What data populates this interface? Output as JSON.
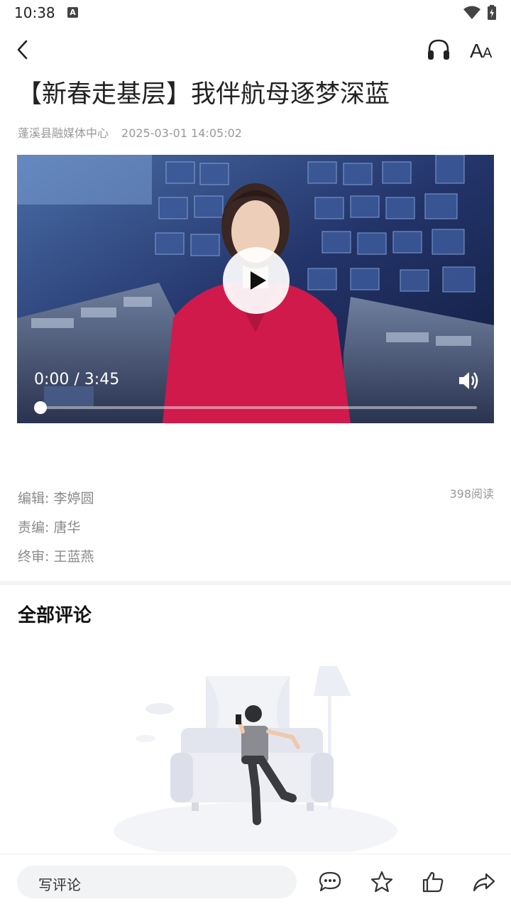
{
  "status_bar": {
    "time": "10:38",
    "notification_icon": "A"
  },
  "top_bar": {
    "back_icon": "chevron-left",
    "listen_icon": "headphones",
    "font_icon": "font-size"
  },
  "article": {
    "title": "【新春走基层】我伴航母逐梦深蓝",
    "source": "蓬溪县融媒体中心",
    "datetime": "2025-03-01 14:05:02"
  },
  "video": {
    "time_display": "0:00 / 3:45",
    "progress": 0.0
  },
  "credits": {
    "editor": "编辑: 李婷圆",
    "responsible_editor": "责编: 唐华",
    "final_review": "终审: 王蓝燕",
    "reads": "398阅读"
  },
  "comments": {
    "title": "全部评论"
  },
  "bottom_bar": {
    "comment_placeholder": "写评论",
    "icons": [
      "comment-icon",
      "star-icon",
      "thumbs-up-icon",
      "share-icon"
    ]
  }
}
